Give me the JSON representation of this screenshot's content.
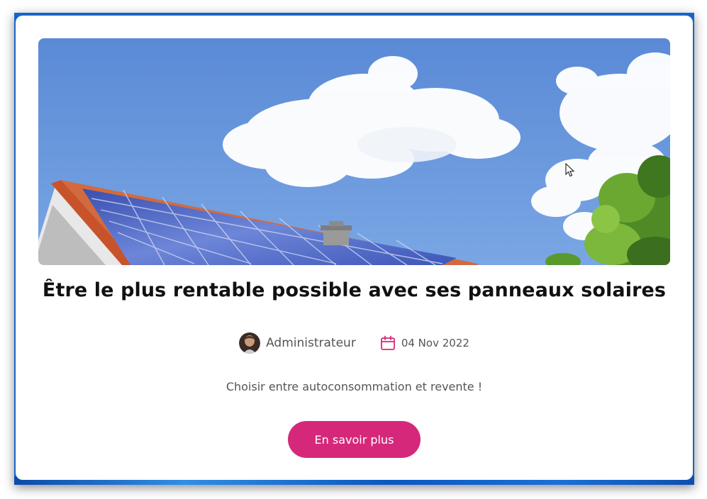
{
  "article": {
    "title": "Être le plus rentable possible avec ses panneaux solaires",
    "author": "Administrateur",
    "date": "04 Nov 2022",
    "excerpt": "Choisir entre autoconsommation et revente !",
    "cta_label": "En savoir plus"
  },
  "icons": {
    "calendar": "calendar-icon",
    "avatar": "author-avatar",
    "cursor": "mouse-cursor"
  },
  "colors": {
    "accent": "#d6287a",
    "frame": "#1565c8",
    "title": "#111111",
    "muted": "#555555",
    "sky": "#6a9be0"
  }
}
